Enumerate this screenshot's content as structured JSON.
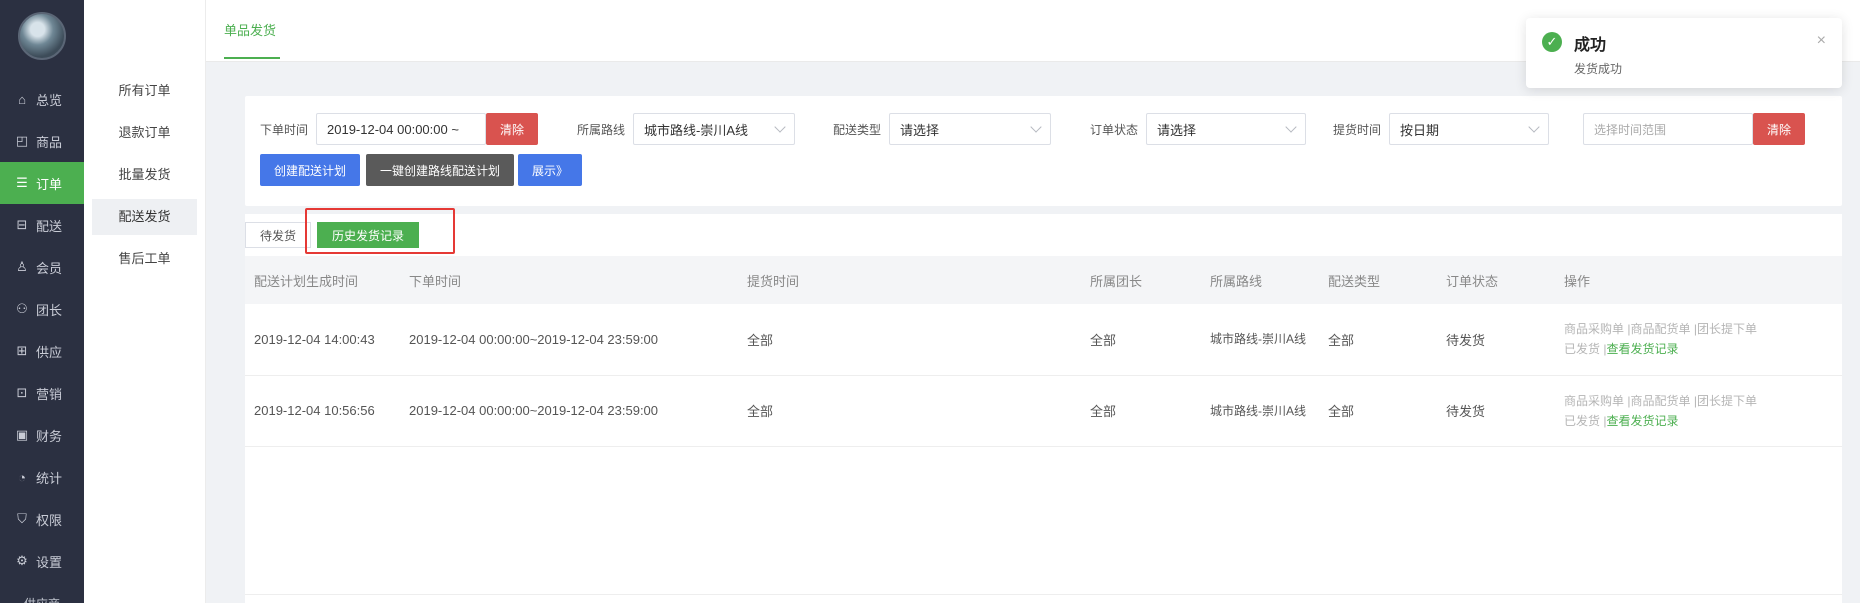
{
  "nav": {
    "items": [
      {
        "label": "总览",
        "icon": "home-icon"
      },
      {
        "label": "商品",
        "icon": "bag-icon"
      },
      {
        "label": "订单",
        "icon": "order-icon"
      },
      {
        "label": "配送",
        "icon": "truck-icon"
      },
      {
        "label": "会员",
        "icon": "user-icon"
      },
      {
        "label": "团长",
        "icon": "leader-icon"
      },
      {
        "label": "供应",
        "icon": "supply-icon"
      },
      {
        "label": "营销",
        "icon": "gift-icon"
      },
      {
        "label": "财务",
        "icon": "finance-icon"
      },
      {
        "label": "统计",
        "icon": "chart-icon"
      },
      {
        "label": "权限",
        "icon": "shield-icon"
      },
      {
        "label": "设置",
        "icon": "gear-icon"
      }
    ],
    "more": "供应商"
  },
  "submenu": [
    "所有订单",
    "退款订单",
    "批量发货",
    "配送发货",
    "售后工单"
  ],
  "topbar": {
    "tab": "单品发货"
  },
  "filters": {
    "order_time_label": "下单时间",
    "order_time_value": "2019-12-04 00:00:00 ~",
    "clear": "清除",
    "route_label": "所属路线",
    "route_value": "城市路线-崇川A线",
    "delivery_type_label": "配送类型",
    "delivery_type_value": "请选择",
    "order_status_label": "订单状态",
    "order_status_value": "请选择",
    "pickup_time_label": "提货时间",
    "pickup_time_value": "按日期",
    "range_placeholder": "选择时间范围",
    "clear2": "清除",
    "btn_create": "创建配送计划",
    "btn_batch": "一键创建路线配送计划",
    "btn_show": "展示》"
  },
  "subtabs": {
    "pending": "待发货",
    "history": "历史发货记录"
  },
  "table": {
    "headers": [
      "配送计划生成时间",
      "下单时间",
      "提货时间",
      "所属团长",
      "所属路线",
      "配送类型",
      "订单状态",
      "操作"
    ],
    "rows": [
      {
        "created": "2019-12-04 14:00:43",
        "order_time": "2019-12-04 00:00:00~2019-12-04 23:59:00",
        "pickup": "全部",
        "leader": "全部",
        "route": "城市路线-崇川A线",
        "type": "全部",
        "status": "待发货",
        "op1": "商品采购单",
        "op2": "商品配货单",
        "op3": "团长提下单",
        "op4": "已发货",
        "op5": "查看发货记录"
      },
      {
        "created": "2019-12-04 10:56:56",
        "order_time": "2019-12-04 00:00:00~2019-12-04 23:59:00",
        "pickup": "全部",
        "leader": "全部",
        "route": "城市路线-崇川A线",
        "type": "全部",
        "status": "待发货",
        "op1": "商品采购单",
        "op2": "商品配货单",
        "op3": "团长提下单",
        "op4": "已发货",
        "op5": "查看发货记录"
      }
    ]
  },
  "toast": {
    "title": "成功",
    "message": "发货成功",
    "close": "×"
  },
  "colors": {
    "accent": "#4caf50",
    "danger": "#d9534f",
    "primary": "#4577e8",
    "nav_bg": "#2b3041"
  }
}
